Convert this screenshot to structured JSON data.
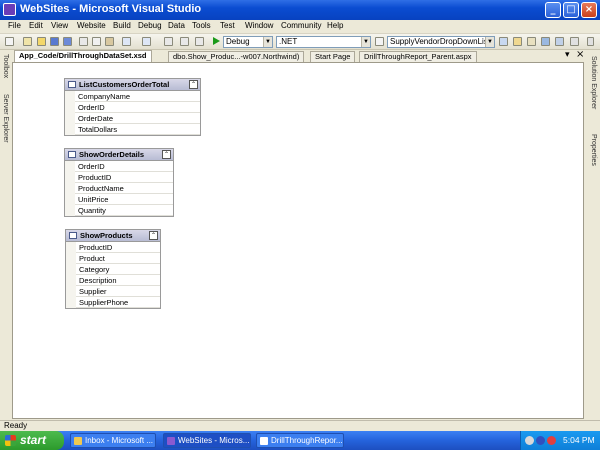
{
  "window": {
    "title": "WebSites - Microsoft Visual Studio",
    "minimize": "_",
    "maximize": "□",
    "close": "×"
  },
  "menu": [
    "File",
    "Edit",
    "View",
    "Website",
    "Build",
    "Debug",
    "Data",
    "Tools",
    "Test",
    "Window",
    "Community",
    "Help"
  ],
  "toolbar": {
    "config_combo": "Debug",
    "platform_combo": ".NET",
    "find_combo": "SupplyVendorDropDownList"
  },
  "side_left": {
    "toolbox": "Toolbox",
    "server_explorer": "Server Explorer"
  },
  "side_right": {
    "solution_explorer": "Solution Explorer",
    "properties": "Properties"
  },
  "tabs": [
    {
      "label": "App_Code/DrillThroughDataSet.xsd",
      "active": true
    },
    {
      "label": "dbo.Show_Produc...-w007.Northwind)",
      "active": false
    },
    {
      "label": "Start Page",
      "active": false
    },
    {
      "label": "DrillThroughReport_Parent.aspx",
      "active": false
    }
  ],
  "tab_controls": {
    "dropdown": "▾",
    "close": "×"
  },
  "tables": [
    {
      "name": "ListCustomersOrderTotal",
      "columns": [
        "CompanyName",
        "OrderID",
        "OrderDate",
        "TotalDollars"
      ]
    },
    {
      "name": "ShowOrderDetails",
      "columns": [
        "OrderID",
        "ProductID",
        "ProductName",
        "UnitPrice",
        "Quantity"
      ]
    },
    {
      "name": "ShowProducts",
      "columns": [
        "ProductID",
        "Product",
        "Category",
        "Description",
        "Supplier",
        "SupplierPhone"
      ]
    }
  ],
  "collapse_glyph": "⌃",
  "status": "Ready",
  "taskbar": {
    "start": "start",
    "tasks": [
      {
        "label": "Inbox - Microsoft ...",
        "active": false
      },
      {
        "label": "WebSites - Micros...",
        "active": true
      },
      {
        "label": "DrillThroughRepor...",
        "active": false
      }
    ],
    "clock": "5:04 PM"
  },
  "colors": {
    "titlebar": "#0a4cd1",
    "taskbar": "#2563dc",
    "start": "#2c9a2c"
  }
}
